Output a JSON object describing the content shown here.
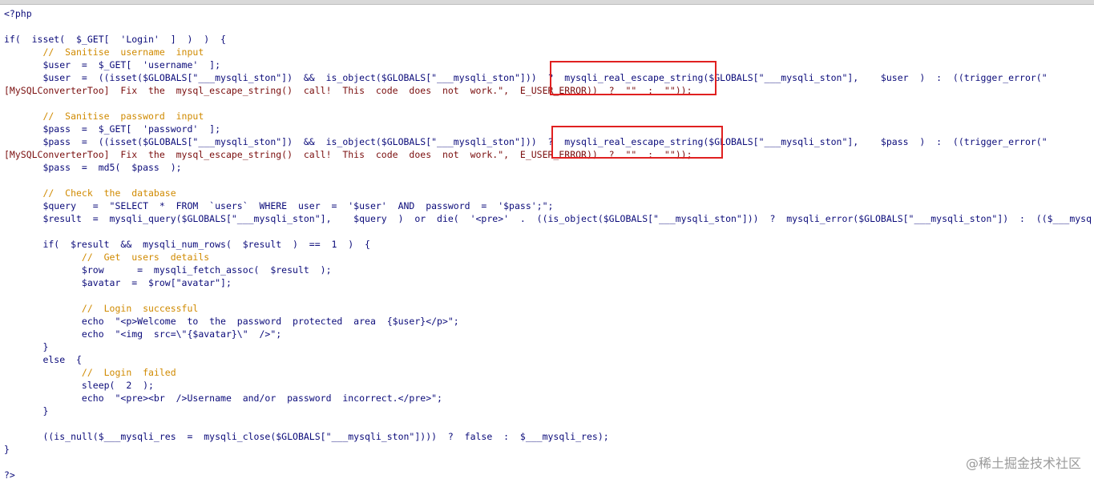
{
  "code_lines": [
    {
      "text": "<?php",
      "kind": "code"
    },
    {
      "text": "",
      "kind": "code"
    },
    {
      "text": "if(  isset(  $_GET[  'Login'  ]  )  )  {",
      "kind": "code"
    },
    {
      "text": "       //  Sanitise  username  input",
      "kind": "comment"
    },
    {
      "text": "       $user  =  $_GET[  'username'  ];",
      "kind": "code"
    },
    {
      "text": "       $user  =  ((isset($GLOBALS[\"___mysqli_ston\"])  &&  is_object($GLOBALS[\"___mysqli_ston\"]))  ?  mysqli_real_escape_string($GLOBALS[\"___mysqli_ston\"],    $user  )  :  ((trigger_error(\"",
      "kind": "code"
    },
    {
      "text": "[MySQLConverterToo]  Fix  the  mysql_escape_string()  call!  This  code  does  not  work.\",  E_USER_ERROR))  ?  \"\"  :  \"\"));",
      "kind": "msg"
    },
    {
      "text": "",
      "kind": "code"
    },
    {
      "text": "       //  Sanitise  password  input",
      "kind": "comment"
    },
    {
      "text": "       $pass  =  $_GET[  'password'  ];",
      "kind": "code"
    },
    {
      "text": "       $pass  =  ((isset($GLOBALS[\"___mysqli_ston\"])  &&  is_object($GLOBALS[\"___mysqli_ston\"]))  ?  mysqli_real_escape_string($GLOBALS[\"___mysqli_ston\"],    $pass  )  :  ((trigger_error(\"",
      "kind": "code"
    },
    {
      "text": "[MySQLConverterToo]  Fix  the  mysql_escape_string()  call!  This  code  does  not  work.\",  E_USER_ERROR))  ?  \"\"  :  \"\"));",
      "kind": "msg"
    },
    {
      "text": "       $pass  =  md5(  $pass  );",
      "kind": "code"
    },
    {
      "text": "",
      "kind": "code"
    },
    {
      "text": "       //  Check  the  database",
      "kind": "comment"
    },
    {
      "text": "       $query   =  \"SELECT  *  FROM  `users`  WHERE  user  =  '$user'  AND  password  =  '$pass';\";",
      "kind": "code"
    },
    {
      "text": "       $result  =  mysqli_query($GLOBALS[\"___mysqli_ston\"],    $query  )  or  die(  '<pre>'  .  ((is_object($GLOBALS[\"___mysqli_ston\"]))  ?  mysqli_error($GLOBALS[\"___mysqli_ston\"])  :  (($___mysq",
      "kind": "code"
    },
    {
      "text": "",
      "kind": "code"
    },
    {
      "text": "       if(  $result  &&  mysqli_num_rows(  $result  )  ==  1  )  {",
      "kind": "code"
    },
    {
      "text": "              //  Get  users  details",
      "kind": "comment"
    },
    {
      "text": "              $row      =  mysqli_fetch_assoc(  $result  );",
      "kind": "code"
    },
    {
      "text": "              $avatar  =  $row[\"avatar\"];",
      "kind": "code"
    },
    {
      "text": "",
      "kind": "code"
    },
    {
      "text": "              //  Login  successful",
      "kind": "comment"
    },
    {
      "text": "              echo  \"<p>Welcome  to  the  password  protected  area  {$user}</p>\";",
      "kind": "code"
    },
    {
      "text": "              echo  \"<img  src=\\\"{$avatar}\\\"  />\";",
      "kind": "code"
    },
    {
      "text": "       }",
      "kind": "code"
    },
    {
      "text": "       else  {",
      "kind": "code"
    },
    {
      "text": "              //  Login  failed",
      "kind": "comment"
    },
    {
      "text": "              sleep(  2  );",
      "kind": "code"
    },
    {
      "text": "              echo  \"<pre><br  />Username  and/or  password  incorrect.</pre>\";",
      "kind": "code"
    },
    {
      "text": "       }",
      "kind": "code"
    },
    {
      "text": "",
      "kind": "code"
    },
    {
      "text": "       ((is_null($___mysqli_res  =  mysqli_close($GLOBALS[\"___mysqli_ston\"])))  ?  false  :  $___mysqli_res);",
      "kind": "code"
    },
    {
      "text": "}",
      "kind": "code"
    },
    {
      "text": "",
      "kind": "code"
    },
    {
      "text": "?>",
      "kind": "code"
    }
  ],
  "watermark": "@稀土掘金技术社区",
  "colors": {
    "code": "#0b0b7a",
    "comment": "#d08a00",
    "message": "#7a0e0e",
    "highlight_box": "#e02020"
  }
}
